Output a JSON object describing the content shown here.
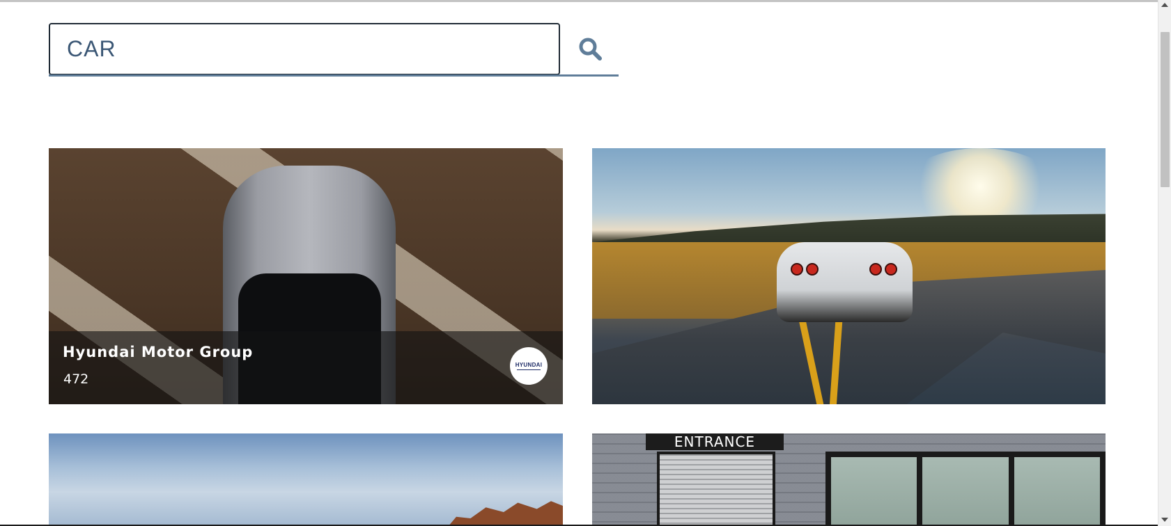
{
  "search": {
    "value": "CAR",
    "button_icon": "search-icon"
  },
  "colors": {
    "search_text": "#3b5775",
    "search_border": "#1f2a35",
    "search_underline": "#5f7d99",
    "overlay": "rgba(20,20,20,0.62)"
  },
  "cards": [
    {
      "title": "Hyundai Motor Group",
      "count": "472",
      "logo_text": "HYUNDAI",
      "image": "car-top-view-photo"
    },
    {
      "title": "",
      "count": "",
      "image": "sports-car-on-road-photo"
    },
    {
      "title": "",
      "count": "",
      "image": "sky-and-rocks-photo"
    },
    {
      "title": "",
      "count": "",
      "image": "building-entrance-photo",
      "sign_text": "ENTRANCE"
    }
  ]
}
